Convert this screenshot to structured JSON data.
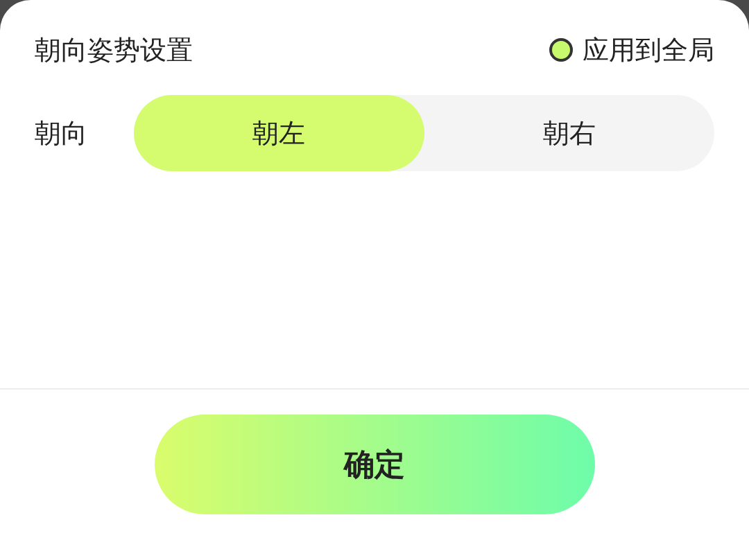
{
  "title": "朝向姿势设置",
  "apply_global": {
    "label": "应用到全局",
    "checked": true
  },
  "orientation": {
    "label": "朝向",
    "options": [
      {
        "label": "朝左",
        "selected": true
      },
      {
        "label": "朝右",
        "selected": false
      }
    ]
  },
  "confirm_button": "确定"
}
